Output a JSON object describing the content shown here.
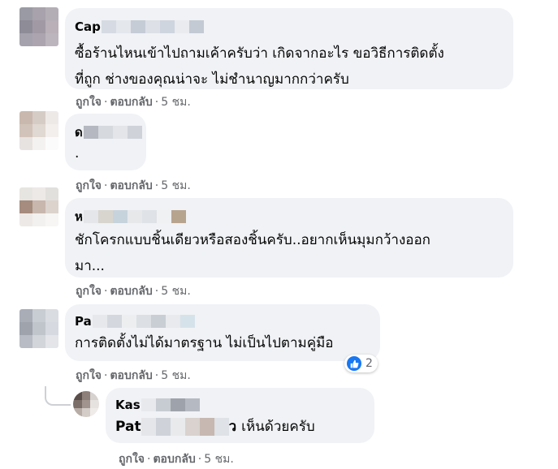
{
  "comments": [
    {
      "name_prefix": "Cap",
      "text": "ซื้อร้านไหนเข้าไปถามเค้าครับว่า เกิดจากอะไร ขอวิธีการติดตั้ง\nที่ถูก ช่างของคุณน่าจะ ไม่ชำนาญมากกว่าครับ",
      "actions": {
        "like": "ถูกใจ",
        "reply": "ตอบกลับ",
        "time": "5 ชม."
      }
    },
    {
      "name_prefix": "ด",
      "text": ".",
      "actions": {
        "like": "ถูกใจ",
        "reply": "ตอบกลับ",
        "time": "5 ชม."
      }
    },
    {
      "name_prefix": "ห",
      "text": "ชักโครกแบบชิ้นเดียวหรือสองชิ้นครับ..อยากเห็นมุมกว้างออก\nมา...",
      "actions": {
        "like": "ถูกใจ",
        "reply": "ตอบกลับ",
        "time": "5 ชม."
      }
    },
    {
      "name_prefix": "Pa",
      "text": "การติดตั้งไม่ได้มาตรฐาน ไม่เป็นไปตามคู่มือ",
      "reaction_count": "2",
      "actions": {
        "like": "ถูกใจ",
        "reply": "ตอบกลับ",
        "time": "5 ชม."
      }
    }
  ],
  "reply": {
    "name_prefix": "Kas",
    "mention_prefix": "Pat",
    "mention_suffix": "ว",
    "text": "เห็นด้วยครับ",
    "actions": {
      "like": "ถูกใจ",
      "reply": "ตอบกลับ",
      "time": "5 ชม."
    }
  },
  "separator": "·",
  "colors": {
    "bubble": "#f0f2f5",
    "meta": "#65676b",
    "like_blue": "#1877f2"
  },
  "icons": {
    "like": "thumbs-up-icon"
  }
}
